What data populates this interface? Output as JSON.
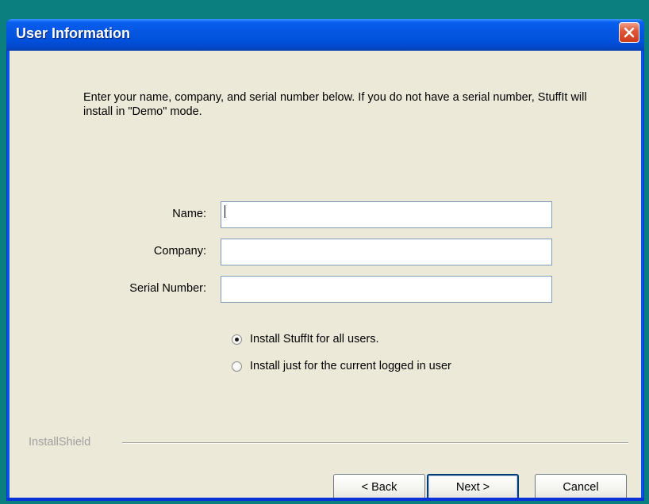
{
  "window": {
    "title": "User Information"
  },
  "intro": {
    "text": "Enter your name, company, and serial number below.  If you do not have a serial number, StuffIt will install in \"Demo\" mode."
  },
  "fields": {
    "name_label": "Name:",
    "name_value": "",
    "company_label": "Company:",
    "company_value": "",
    "serial_label": "Serial Number:",
    "serial_value": ""
  },
  "options": {
    "all_users_label": "Install StuffIt for all users.",
    "current_user_label": "Install just for the current logged in user",
    "selected": "all_users"
  },
  "footer": {
    "brand": "InstallShield",
    "back_label": "< Back",
    "next_label": "Next >",
    "cancel_label": "Cancel"
  },
  "colors": {
    "titlebar": "#0054e3",
    "dialog_background": "#ece9d8",
    "close_button": "#e0583a",
    "desktop": "#0a7f80"
  },
  "icons": {
    "close": "close-x-icon"
  }
}
